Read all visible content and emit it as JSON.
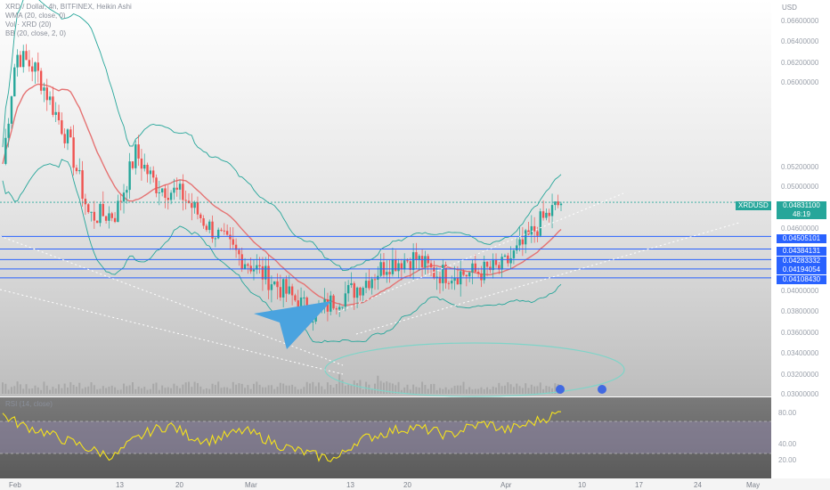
{
  "legend": {
    "title": "XRD / Dollar, 4h, BITFINEX, Heikin Ashi",
    "wma": "WMA (20, close, 0)",
    "vol": "Vol · XRD (20)",
    "bb": "BB (20, close, 2, 0)"
  },
  "currency": "USD",
  "rsi_label": "RSI (14, close)",
  "price_axis": [
    "0.06600000",
    "0.06400000",
    "0.06200000",
    "0.06000000",
    "0.05200000",
    "0.05000000",
    "0.04600000",
    "0.04000000",
    "0.03800000",
    "0.03600000",
    "0.03400000",
    "0.03200000"
  ],
  "price_axis_bottom": "0.03000000",
  "rsi_axis": [
    "80.00",
    "40.00",
    "20.00"
  ],
  "date_axis": [
    "Feb",
    "13",
    "20",
    "Mar",
    "13",
    "20",
    "Apr",
    "10",
    "17",
    "24",
    "May"
  ],
  "levels": [
    "0.04505101",
    "0.04384131",
    "0.04283332",
    "0.04194054",
    "0.04108430"
  ],
  "last": {
    "symbol": "XRDUSD",
    "price": "0.04831100",
    "countdown": "48:19"
  },
  "colors": {
    "up": "#26a69a",
    "down": "#ef5350",
    "level": "#2962ff",
    "rsi": "#f5e21b",
    "bb": "#26a69a",
    "wma": "#e57373",
    "arrow": "#4aa3df"
  },
  "chart_data": {
    "type": "candlestick",
    "title": "XRD / Dollar, 4h, BITFINEX, Heikin Ashi",
    "x_range": [
      "Feb",
      "May"
    ],
    "ylim": [
      0.03,
      0.0668
    ],
    "series": [
      {
        "name": "XRD / Dollar",
        "approx_close_points": [
          [
            0,
            0.052
          ],
          [
            0.02,
            0.0625
          ],
          [
            0.05,
            0.061
          ],
          [
            0.1,
            0.054
          ],
          [
            0.13,
            0.047
          ],
          [
            0.17,
            0.0472
          ],
          [
            0.2,
            0.053
          ],
          [
            0.23,
            0.05
          ],
          [
            0.27,
            0.049
          ],
          [
            0.31,
            0.046
          ],
          [
            0.35,
            0.0435
          ],
          [
            0.4,
            0.041
          ],
          [
            0.44,
            0.039
          ],
          [
            0.47,
            0.0375
          ],
          [
            0.5,
            0.039
          ],
          [
            0.53,
            0.04
          ],
          [
            0.58,
            0.0425
          ],
          [
            0.62,
            0.043
          ],
          [
            0.65,
            0.0415
          ],
          [
            0.7,
            0.0415
          ],
          [
            0.75,
            0.042
          ],
          [
            0.78,
            0.044
          ],
          [
            0.81,
            0.0465
          ],
          [
            0.84,
            0.0483
          ]
        ]
      }
    ],
    "horizontal_levels": [
      0.04505101,
      0.04384131,
      0.04283332,
      0.04194054,
      0.0410843
    ],
    "last_price": 0.048311,
    "rsi": {
      "name": "RSI (14, close)",
      "ylim": [
        10,
        85
      ],
      "levels": [
        70,
        30
      ],
      "approx_values": [
        70,
        60,
        55,
        48,
        42,
        35,
        30,
        45,
        55,
        60,
        50,
        45,
        50,
        55,
        48,
        40,
        35,
        30,
        28,
        45,
        50,
        55,
        58,
        55,
        50,
        58,
        62,
        55,
        60,
        66,
        72
      ]
    }
  }
}
